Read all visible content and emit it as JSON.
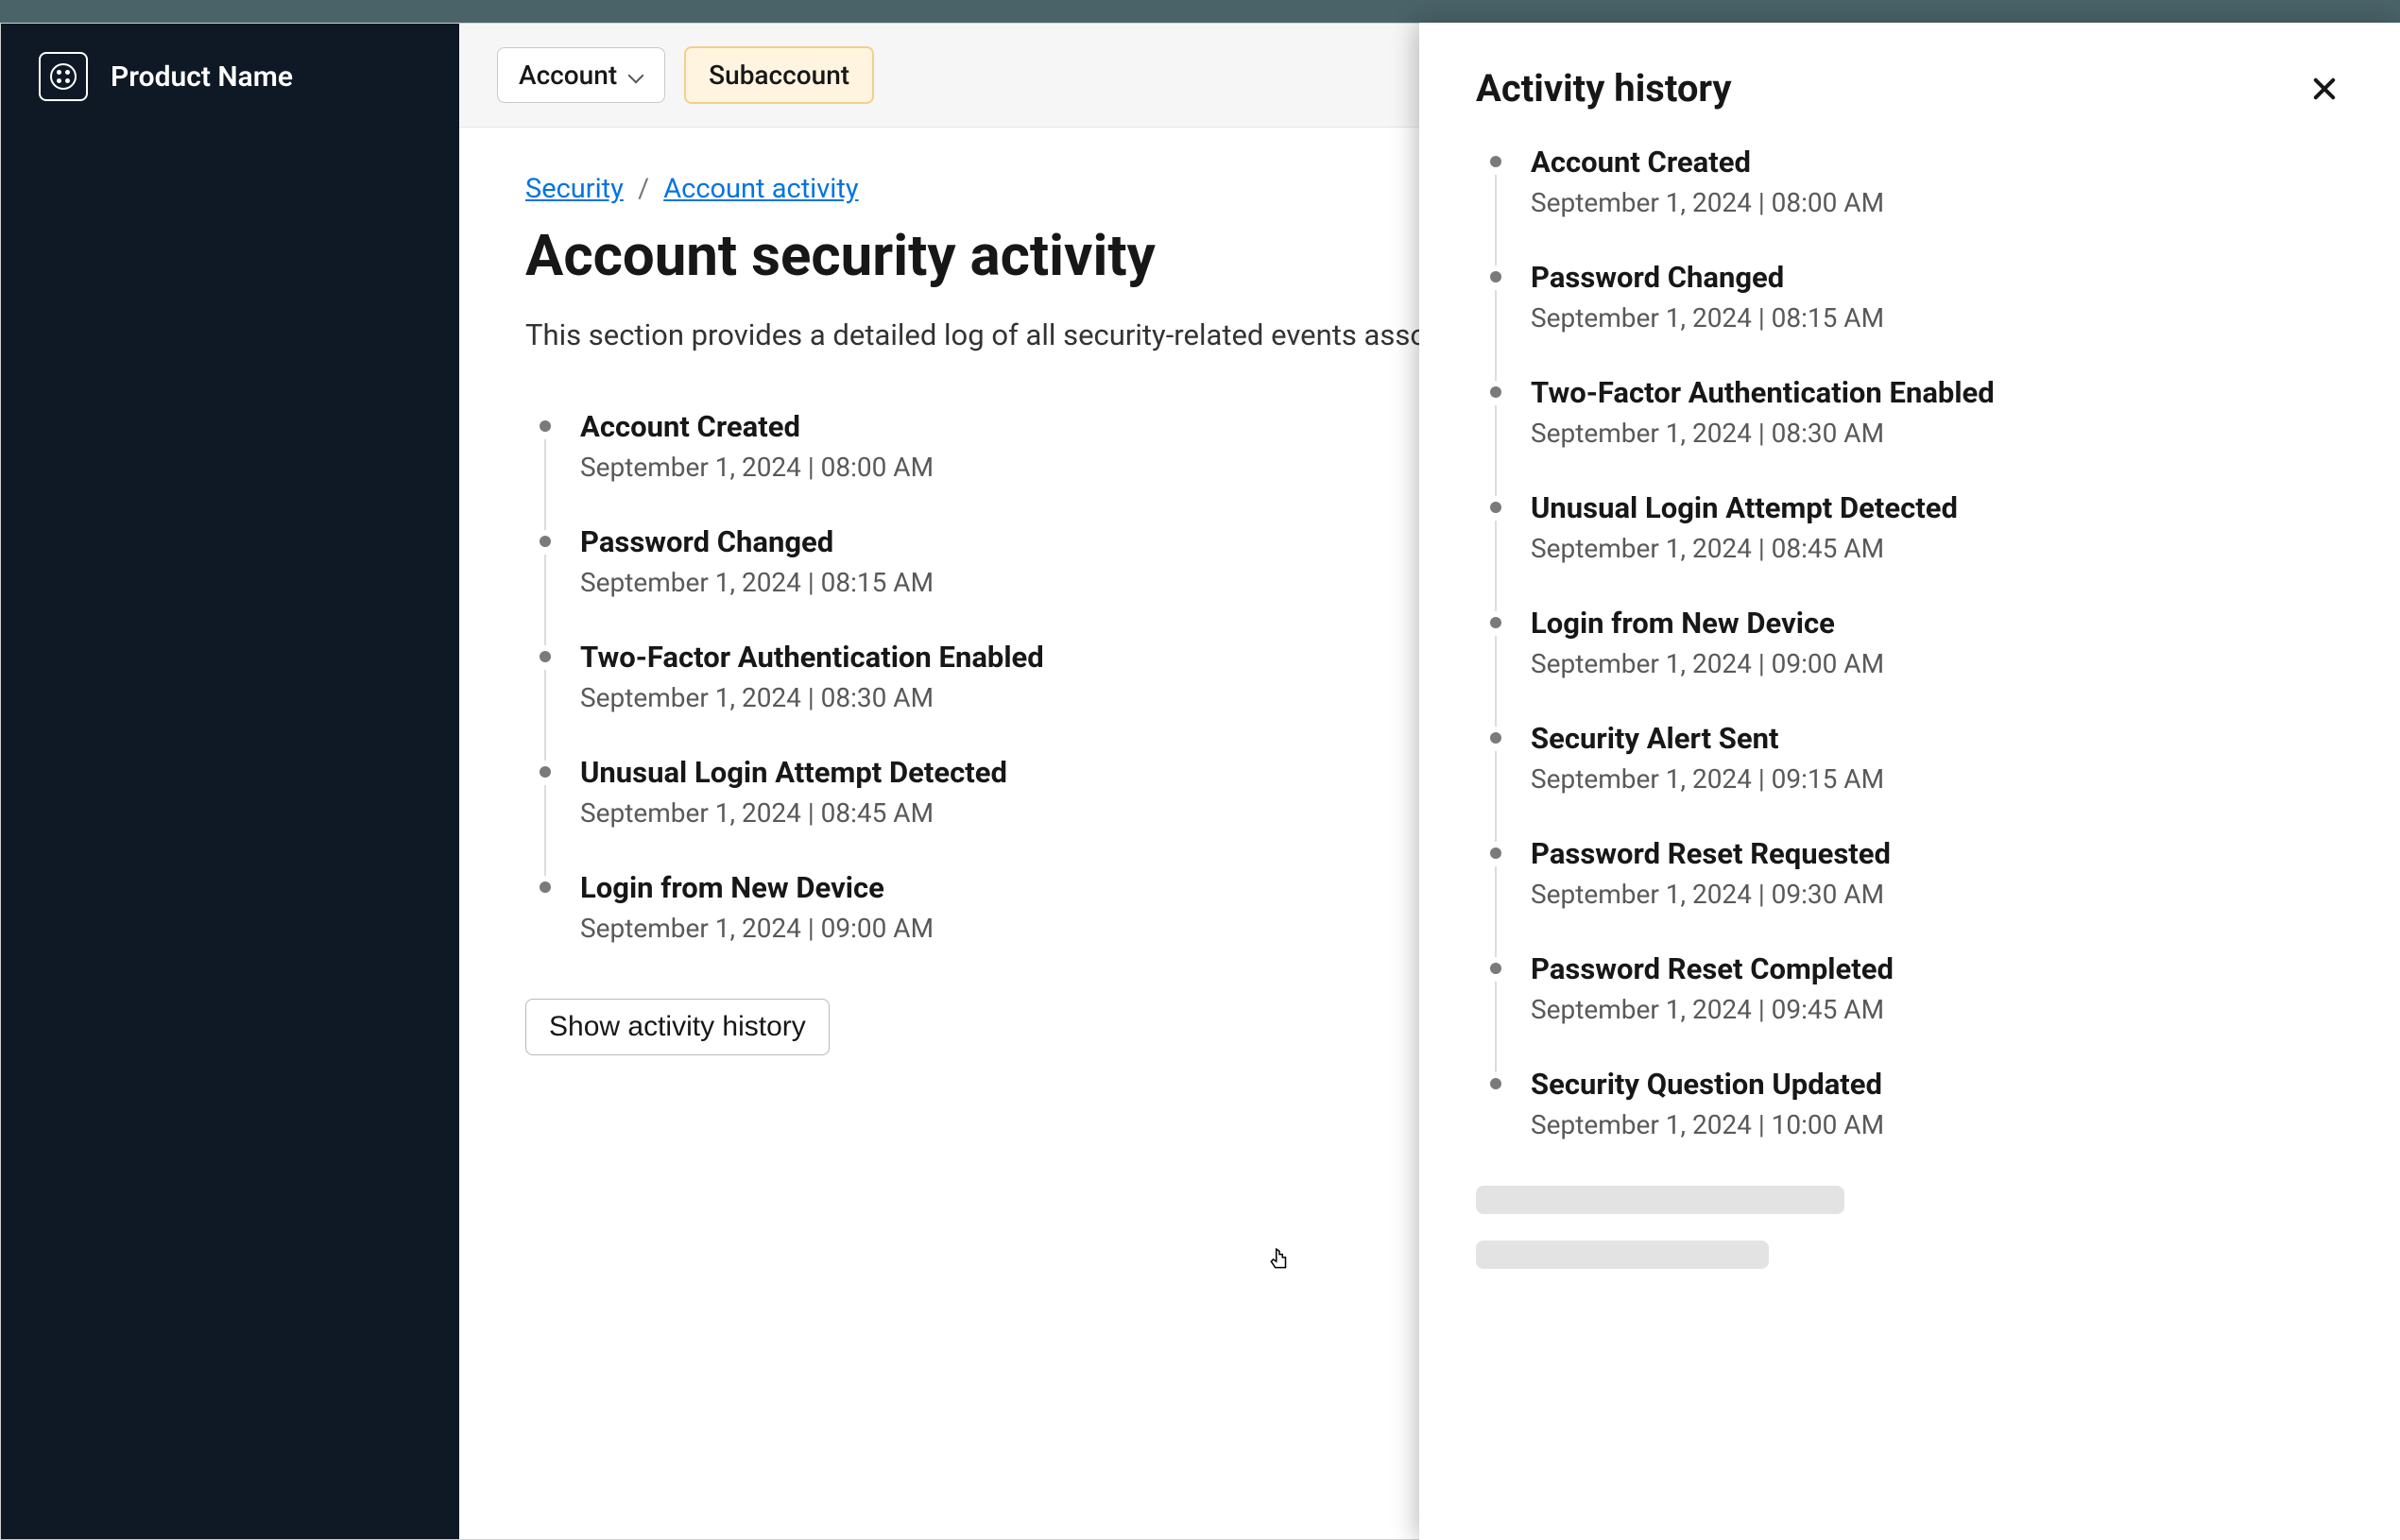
{
  "sidebar": {
    "product_name": "Product Name"
  },
  "topbar": {
    "account_label": "Account",
    "subaccount_label": "Subaccount"
  },
  "breadcrumb": {
    "root": "Security",
    "separator": "/",
    "current": "Account activity"
  },
  "page": {
    "title": "Account security activity",
    "description": "This section provides a detailed log of all security-related events asso"
  },
  "main_timeline": [
    {
      "title": "Account Created",
      "date": "September 1, 2024 | 08:00 AM"
    },
    {
      "title": "Password Changed",
      "date": "September 1, 2024 | 08:15 AM"
    },
    {
      "title": "Two-Factor Authentication Enabled",
      "date": "September 1, 2024 | 08:30 AM"
    },
    {
      "title": "Unusual Login Attempt Detected",
      "date": "September 1, 2024 | 08:45 AM"
    },
    {
      "title": "Login from New Device",
      "date": "September 1, 2024 | 09:00 AM"
    }
  ],
  "buttons": {
    "show_history": "Show activity history"
  },
  "drawer": {
    "title": "Activity history",
    "timeline": [
      {
        "title": "Account Created",
        "date": "September 1, 2024 | 08:00 AM"
      },
      {
        "title": "Password Changed",
        "date": "September 1, 2024 | 08:15 AM"
      },
      {
        "title": "Two-Factor Authentication Enabled",
        "date": "September 1, 2024 | 08:30 AM"
      },
      {
        "title": "Unusual Login Attempt Detected",
        "date": "September 1, 2024 | 08:45 AM"
      },
      {
        "title": "Login from New Device",
        "date": "September 1, 2024 | 09:00 AM"
      },
      {
        "title": "Security Alert Sent",
        "date": "September 1, 2024 | 09:15 AM"
      },
      {
        "title": "Password Reset Requested",
        "date": "September 1, 2024 | 09:30 AM"
      },
      {
        "title": "Password Reset Completed",
        "date": "September 1, 2024 | 09:45 AM"
      },
      {
        "title": "Security Question Updated",
        "date": "September 1, 2024 | 10:00 AM"
      }
    ]
  },
  "colors": {
    "sidebar_bg": "#0f1925",
    "link": "#0074e0",
    "subaccount_bg": "#fff4e0",
    "subaccount_border": "#f2d089"
  }
}
